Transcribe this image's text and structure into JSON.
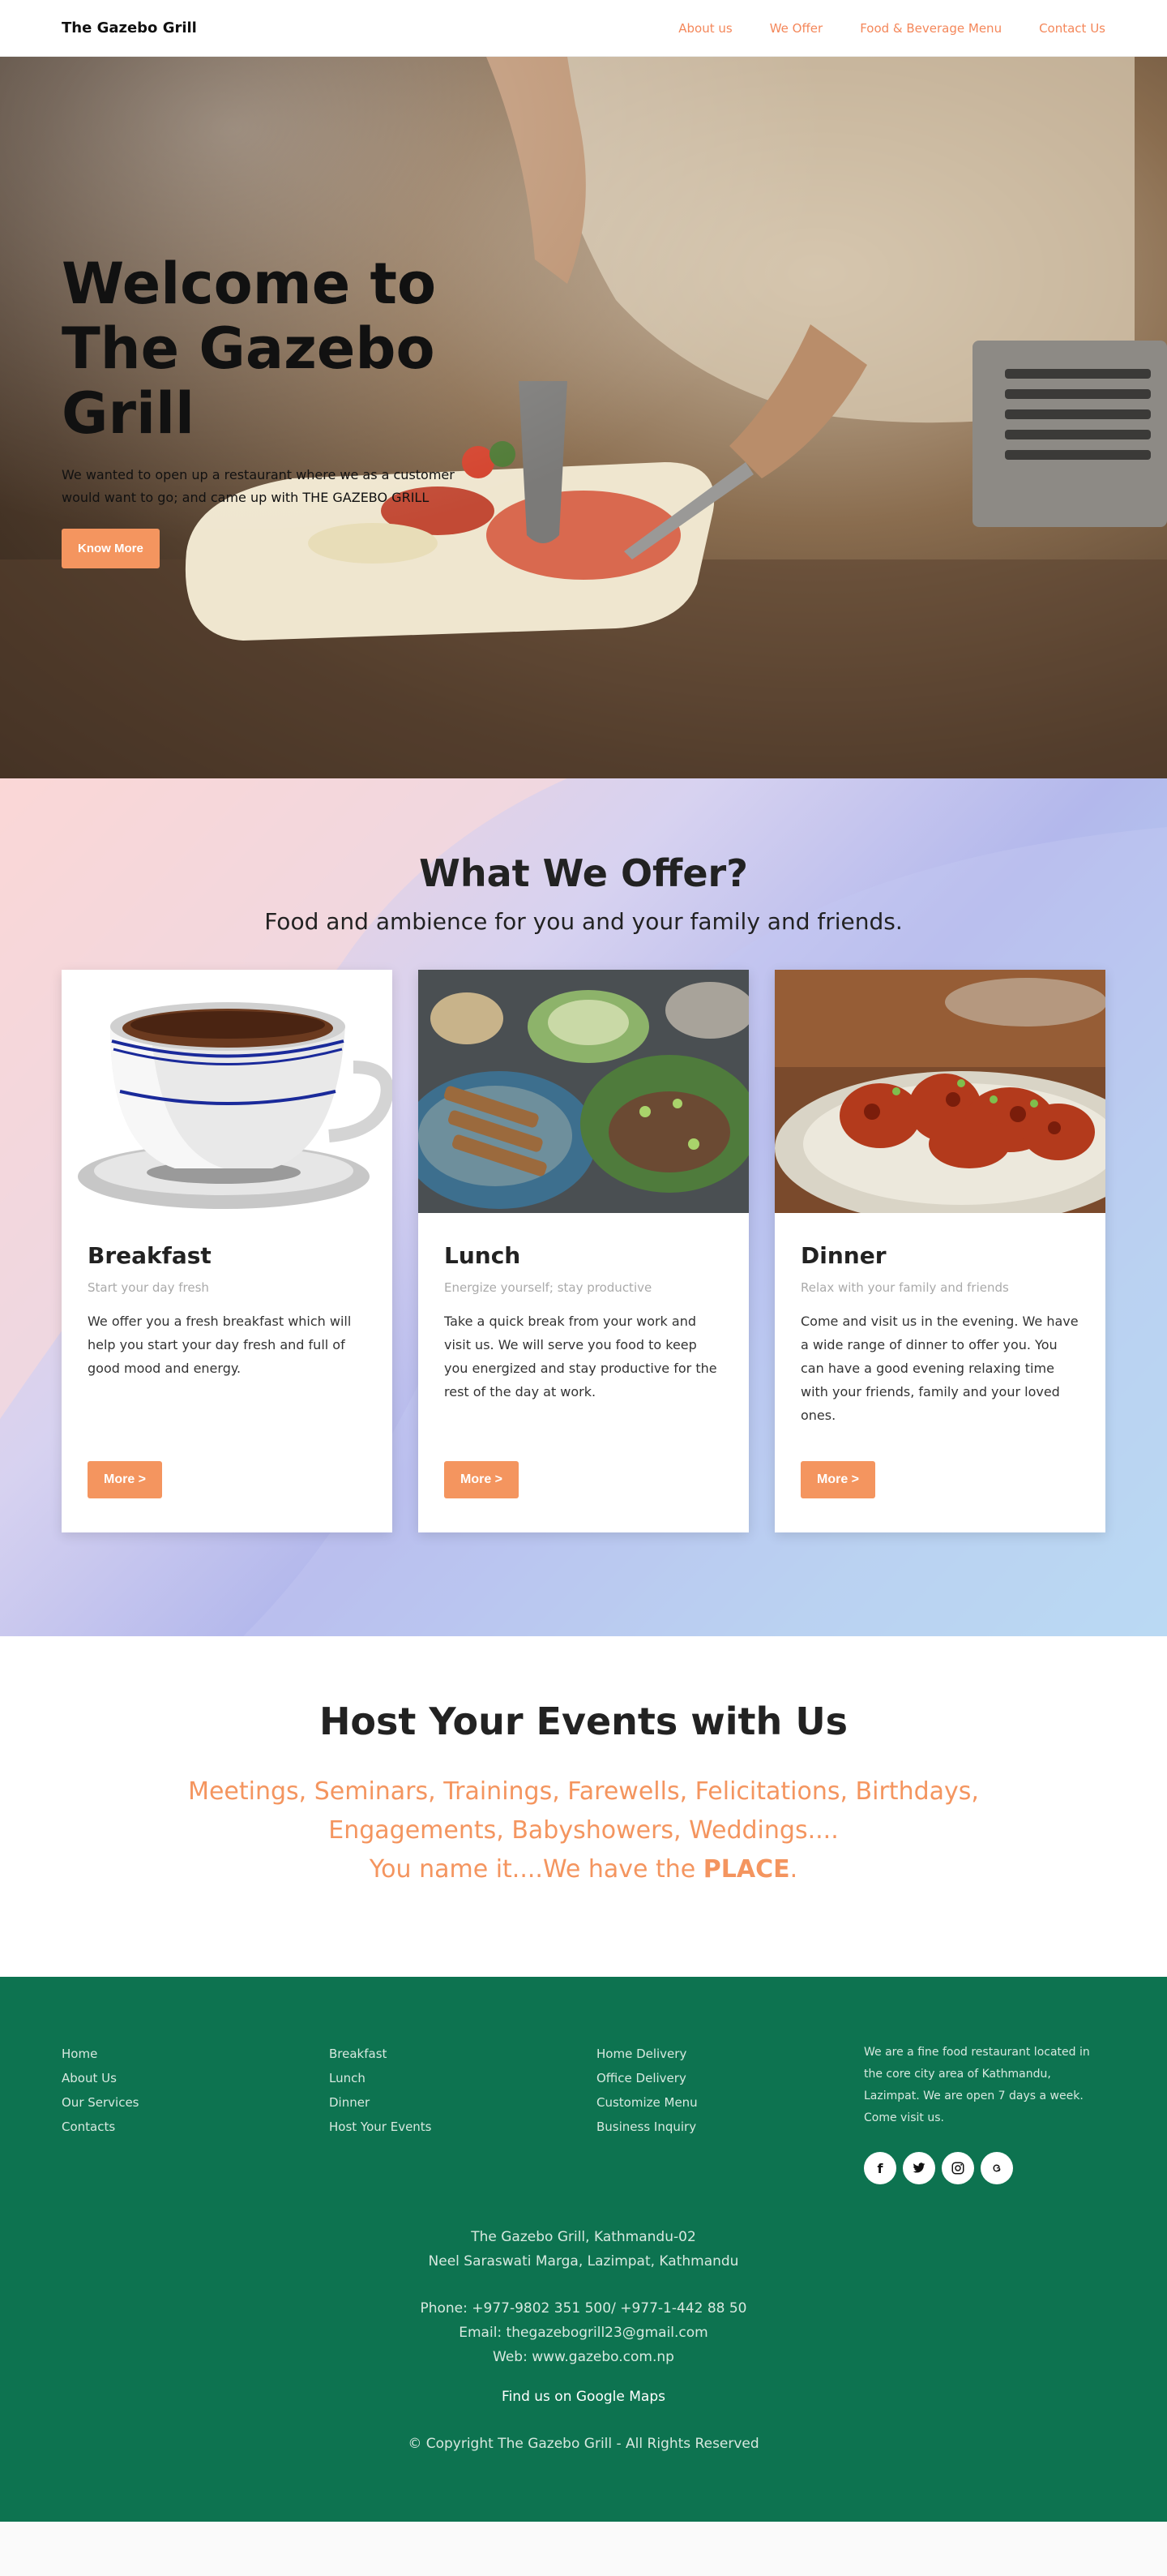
{
  "nav": {
    "brand": "The Gazebo Grill",
    "links": [
      "About us",
      "We Offer",
      "Food & Beverage Menu",
      "Contact Us"
    ]
  },
  "hero": {
    "title_line1": "Welcome to",
    "title_line2": "The Gazebo",
    "title_line3": "Grill",
    "subtitle": "We wanted to open up a restaurant where we as a customer would want to go; and came up with THE GAZEBO GRILL",
    "button": "Know More"
  },
  "offer": {
    "title": "What We Offer?",
    "subtitle": "Food and ambience for you and your family and friends.",
    "cards": [
      {
        "title": "Breakfast",
        "tagline": "Start your day fresh",
        "text": "We offer you a fresh breakfast which will help you start your day fresh and full of good mood and energy.",
        "button": "More >"
      },
      {
        "title": "Lunch",
        "tagline": "Energize yourself; stay productive",
        "text": "Take a quick break from your work and visit us. We will serve you food to keep you energized and stay productive for the rest of the day at work.",
        "button": "More >"
      },
      {
        "title": "Dinner",
        "tagline": "Relax with your family and friends",
        "text": "Come and visit us in the evening. We have a wide range of dinner to offer you. You can have a good evening relaxing time with your friends, family and your loved ones.",
        "button": "More >"
      }
    ]
  },
  "events": {
    "title": "Host Your Events with Us",
    "line1": "Meetings, Seminars, Trainings, Farewells, Felicitations, Birthdays,",
    "line2": "Engagements, Babyshowers, Weddings....",
    "line3_prefix": "You name it....We have the ",
    "line3_emph": "PLACE",
    "line3_suffix": "."
  },
  "footer": {
    "col1": [
      "Home",
      "About Us",
      "Our Services",
      "Contacts"
    ],
    "col2": [
      "Breakfast",
      "Lunch",
      "Dinner",
      "Host Your Events"
    ],
    "col3": [
      "Home Delivery",
      "Office Delivery",
      "Customize Menu",
      "Business Inquiry"
    ],
    "about": "We are a fine food restaurant located in the core city area of Kathmandu, Lazimpat. We are open 7 days a week. Come visit us.",
    "social_icons": [
      "facebook-icon",
      "twitter-icon",
      "instagram-icon",
      "threads-icon"
    ],
    "address1": "The Gazebo Grill, Kathmandu-02",
    "address2": "Neel Saraswati Marga, Lazimpat, Kathmandu",
    "phone": "Phone: +977-9802 351 500/ +977-1-442 88 50",
    "email": "Email: thegazebogrill23@gmail.com",
    "web": "Web: www.gazebo.com.np",
    "map": "Find us on Google Maps",
    "copyright": "© Copyright The Gazebo Grill - All Rights Reserved"
  },
  "colors": {
    "accent": "#f4955f",
    "footer_bg": "#0d7350"
  }
}
